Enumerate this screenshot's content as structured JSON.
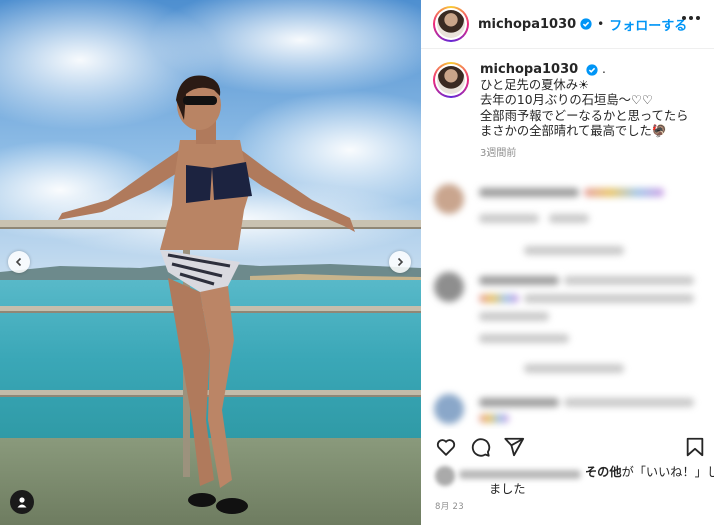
{
  "post": {
    "username": "michopa1030",
    "follow_label": "フォローする",
    "separator": "•",
    "caption_username": "michopa1030",
    "caption_lines": [
      ".",
      "ひと足先の夏休み☀︎",
      "去年の10月ぶりの石垣島〜♡♡",
      "全部雨予報でどーなるかと思ってたら",
      "まさかの全部晴れて最高でした🦃"
    ],
    "posted_ago": "3週間前",
    "likes_text_bold": "その他",
    "likes_text_rest": "が「いいね！」し",
    "likes_text_line2": "ました",
    "date": "8月 23"
  },
  "icons": {
    "verified": "verified-badge-icon",
    "more": "more-options-icon",
    "like": "heart-icon",
    "comment": "comment-icon",
    "share": "paper-plane-icon",
    "save": "bookmark-icon",
    "prev": "chevron-left-icon",
    "next": "chevron-right-icon",
    "tag": "user-tag-icon"
  },
  "colors": {
    "link_blue": "#0095f6",
    "verified_blue": "#0095f6",
    "text": "#262626",
    "muted": "#8e8e8e"
  }
}
